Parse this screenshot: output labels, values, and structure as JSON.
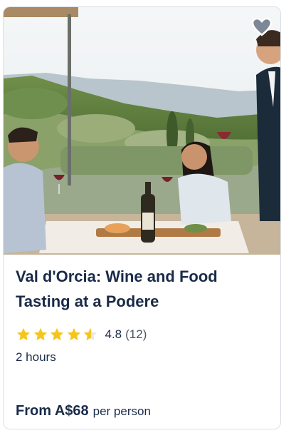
{
  "card": {
    "image_alt": "People tasting wine at an outdoor table overlooking the Val d'Orcia hills",
    "wishlist_icon": "heart-icon",
    "title": "Val d'Orcia: Wine and Food Tasting at a Podere",
    "rating": {
      "value_text": "4.8",
      "count_text": "(12)",
      "stars": 4.8,
      "star_color": "#f5c518"
    },
    "duration": "2 hours",
    "price": {
      "main": "From A$68",
      "suffix": "per person"
    }
  },
  "colors": {
    "title": "#1a2b49",
    "border": "#dcdfe4"
  }
}
